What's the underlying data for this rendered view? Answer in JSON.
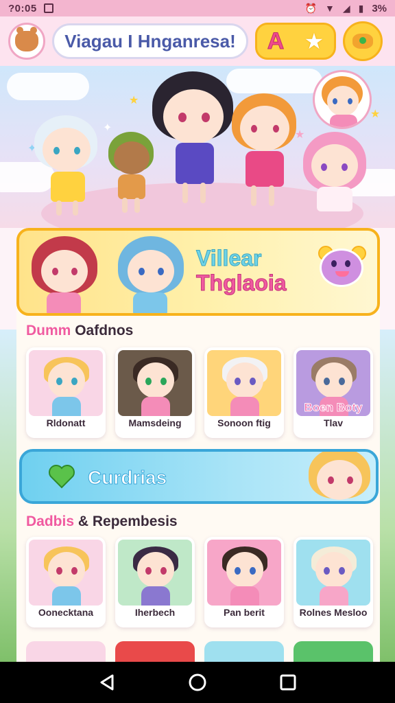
{
  "status_bar": {
    "time": "?0:05",
    "battery": "3%"
  },
  "header": {
    "search_text": "Viagau I Hnganresa!",
    "action_letter": "A"
  },
  "feature_banner": {
    "title_line1": "Villear",
    "title_line2": "Thglaoia"
  },
  "section1": {
    "title_accent": "Dumm",
    "title_rest": "Oafdnos",
    "cards": [
      {
        "label": "Rldonatt",
        "bg": "#f9d6e6",
        "hair": "#f7c45a",
        "eye": "#3aa6c2",
        "shirt": "#7cc6ea"
      },
      {
        "label": "Mamsdeing",
        "bg": "#6b5a4a",
        "hair": "#3a2a24",
        "eye": "#2aa65a",
        "shirt": "#f48cb8"
      },
      {
        "label": "Sonoon ftig",
        "bg": "#ffd57a",
        "hair": "#f2f2f4",
        "eye": "#6a5ac2",
        "shirt": "#f48cb8"
      },
      {
        "label": "Tlav",
        "bg": "#b99be0",
        "hair": "#9a7c66",
        "eye": "#4a6a9a",
        "shirt": "#f48cb8",
        "overlay": "Boen Boty"
      }
    ]
  },
  "cta": {
    "label": "Curdrias"
  },
  "section2": {
    "title_accent": "Dadbis",
    "title_rest": "& Repembesis",
    "cards": [
      {
        "label": "Oonecktana",
        "bg": "#f9d6e6",
        "hair": "#f7c45a",
        "eye": "#c23a6a",
        "shirt": "#7cc6ea"
      },
      {
        "label": "Iherbech",
        "bg": "#bfe8c8",
        "hair": "#3a2a44",
        "eye": "#c23a6a",
        "shirt": "#8a78d0"
      },
      {
        "label": "Pan berit",
        "bg": "#f7a6c8",
        "hair": "#3a2a24",
        "eye": "#3a6ac2",
        "shirt": "#f48cb8"
      },
      {
        "label": "Rolnes Mesloo",
        "bg": "#9fe0ef",
        "hair": "#f4ecd8",
        "eye": "#6a5ac2",
        "shirt": "#f7a6c8"
      }
    ]
  },
  "colors": {
    "accent_pink": "#f05aa0",
    "accent_yellow": "#ffd23f",
    "accent_blue": "#3aa6d8"
  },
  "icons": {
    "back": "back-icon",
    "home": "home-icon",
    "recents": "recents-icon"
  }
}
